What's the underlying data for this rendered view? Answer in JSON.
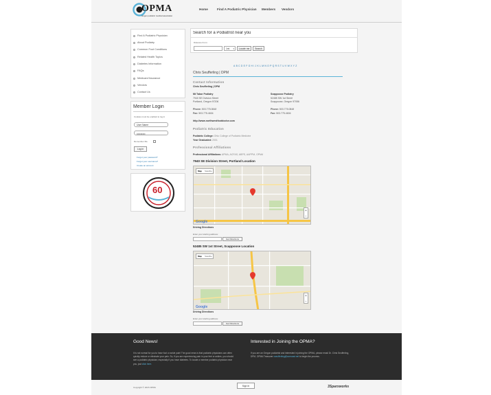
{
  "header": {
    "logo_text": "OPMA",
    "logo_sub": "oregon podiatric medical association",
    "nav": [
      "Home",
      "Find A Podiatric Physician",
      "Members",
      "Vendors"
    ]
  },
  "sidebar": {
    "items": [
      "Find A Podiatric Physician",
      "About Podiatry",
      "Common Foot Conditions",
      "Related Health Topics",
      "Diabetes Information",
      "FAQs",
      "Medicare/Insurance",
      "Vendors",
      "Contact Us"
    ],
    "login": {
      "title": "Member Login",
      "note": "Cookies must be enabled to log in",
      "username_value": "User Name",
      "password_value": "•••••••••",
      "remember_label": "Remember Me",
      "login_button": "Log in",
      "links": [
        "Forgot your password?",
        "Forgot your username?",
        "Create an account"
      ]
    },
    "badge_text": "60"
  },
  "search": {
    "title": "Search for a Podiatrist near you",
    "distance_label": "Distance From:",
    "unit_value": "1mi",
    "locate_button": "Locate me",
    "search_button": "Search"
  },
  "alphabet": [
    "A",
    "B",
    "C",
    "D",
    "E",
    "F",
    "G",
    "H",
    "I",
    "J",
    "K",
    "L",
    "M",
    "N",
    "O",
    "P",
    "Q",
    "R",
    "S",
    "T",
    "U",
    "V",
    "W",
    "X",
    "Y",
    "Z"
  ],
  "profile": {
    "name": "Chris Seufferling | DPM",
    "contact_heading": "Contact Information",
    "contact_name": "Chris Seufferling | DPM",
    "office1": {
      "name": "Mt Tabor Podiatry",
      "line1": "7940 SE Division Street",
      "line2": "Portland, Oregon 97206"
    },
    "office2": {
      "name": "Scappoose Podiatry",
      "line1": "52485 SW 1st Street",
      "line2": "Scappoose, Oregon 97056"
    },
    "phone_label": "Phone:",
    "fax_label": "Fax:",
    "phone1": "503.775.0848",
    "fax1": "503.775.4604",
    "phone2": "503.775.0848",
    "fax2": "503.775.4604",
    "website": "http://www.northwestfootdoctor.com",
    "education_heading": "Podiatric Education",
    "college_label": "Podiatric College:",
    "college": "Ohio College of Podiatric Medicine",
    "year_label": "Year Graduated:",
    "year": "2001",
    "affiliations_heading": "Professional Affiliations",
    "affiliations_label": "Professional Affiliations:",
    "affiliations": "APMA, ACFAS, ABPS, AAPPM, OPMA"
  },
  "locations": [
    {
      "title": "7940 SE Division Street, Portland Location",
      "map_label": "Map",
      "sat_label": "Satellite",
      "driving": "Driving Directions",
      "address_label": "Enter your starting address:",
      "button": "Get Directions"
    },
    {
      "title": "52485 SW 1st Street, Scappoose Location",
      "map_label": "Map",
      "sat_label": "Satellite",
      "driving": "Driving Directions",
      "address_label": "Enter your starting address:",
      "button": "Get Directions"
    }
  ],
  "footer": {
    "left_title": "Good News!",
    "left_text": "It is not normal for you to have foot or ankle pain! The good news is that podiatric physicians can often quickly reduce or eliminate your pain. So, if you are experiencing pain in your feet or ankles, you should see a podiatric physician; especially if you have diabetes. To locate a member podiatric physician near you, just",
    "left_link": "click here.",
    "right_title": "Interested in Joining the OPMA?",
    "right_text": "If you are an Oregon podiatrist and interested in joining the OPMA, please email Dr. Chris Seufferling, DPM, OPMA Treasurer",
    "right_link": "cseufferling@comcast.net",
    "right_tail": "to begin the process."
  },
  "bottom": {
    "copyright": "Copyright © 2015 OPMA",
    "signin": "Sign In",
    "brand": "3Sparxworks"
  },
  "colors": {
    "accent": "#5ab3d8",
    "footer_bg": "#2c2c2c",
    "link": "#2a7ab0"
  }
}
